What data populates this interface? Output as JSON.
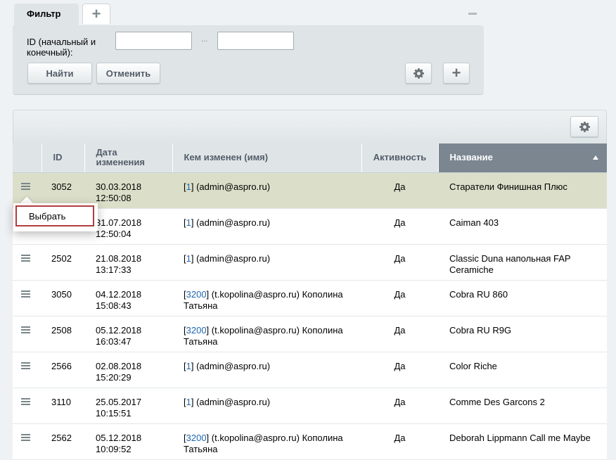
{
  "filter": {
    "tab_label": "Фильтр",
    "add_tab_icon": "plus-icon",
    "collapse_icon": "minus-icon",
    "id_label": "ID (начальный и конечный):",
    "range_separator": "...",
    "from_value": "",
    "to_value": "",
    "find_button": "Найти",
    "cancel_button": "Отменить",
    "settings_icon": "gear-icon",
    "add_field_icon": "plus-icon"
  },
  "grid": {
    "settings_icon": "gear-icon",
    "columns": [
      "",
      "ID",
      "Дата изменения",
      "Кем изменен (имя)",
      "Активность",
      "Название"
    ],
    "sorted_column": "Название",
    "rows": [
      {
        "id": "3052",
        "date": "30.03.2018",
        "time": "12:50:08",
        "user_id": "1",
        "user_rest": "(admin@aspro.ru)",
        "active": "Да",
        "name": "Старатели Финишная Плюс"
      },
      {
        "id": "",
        "date": "31.07.2018",
        "time": "12:50:04",
        "user_id": "1",
        "user_rest": "(admin@aspro.ru)",
        "active": "Да",
        "name": "Caiman 403"
      },
      {
        "id": "2502",
        "date": "21.08.2018",
        "time": "13:17:33",
        "user_id": "1",
        "user_rest": "(admin@aspro.ru)",
        "active": "Да",
        "name": "Classic Duna напольная FAP Ceramiche"
      },
      {
        "id": "3050",
        "date": "04.12.2018",
        "time": "15:08:43",
        "user_id": "3200",
        "user_rest": "(t.kopolina@aspro.ru) Кополина Татьяна",
        "active": "Да",
        "name": "Cobra RU 860"
      },
      {
        "id": "2508",
        "date": "05.12.2018",
        "time": "16:03:47",
        "user_id": "3200",
        "user_rest": "(t.kopolina@aspro.ru) Кополина Татьяна",
        "active": "Да",
        "name": "Cobra RU R9G"
      },
      {
        "id": "2566",
        "date": "02.08.2018",
        "time": "15:20:29",
        "user_id": "1",
        "user_rest": "(admin@aspro.ru)",
        "active": "Да",
        "name": "Color Riche"
      },
      {
        "id": "3110",
        "date": "25.05.2017",
        "time": "10:15:51",
        "user_id": "1",
        "user_rest": "(admin@aspro.ru)",
        "active": "Да",
        "name": "Comme Des Garcons 2"
      },
      {
        "id": "2562",
        "date": "05.12.2018",
        "time": "10:09:52",
        "user_id": "3200",
        "user_rest": "(t.kopolina@aspro.ru) Кополина Татьяна",
        "active": "Да",
        "name": "Deborah Lippmann Call me Maybe"
      }
    ]
  },
  "context_menu": {
    "items": [
      "Выбрать"
    ]
  },
  "colors": {
    "selected_row": "#dbdfc9",
    "sorted_header": "#7b8691",
    "link": "#2067b0",
    "menu_highlight_border": "#b03c3f"
  }
}
